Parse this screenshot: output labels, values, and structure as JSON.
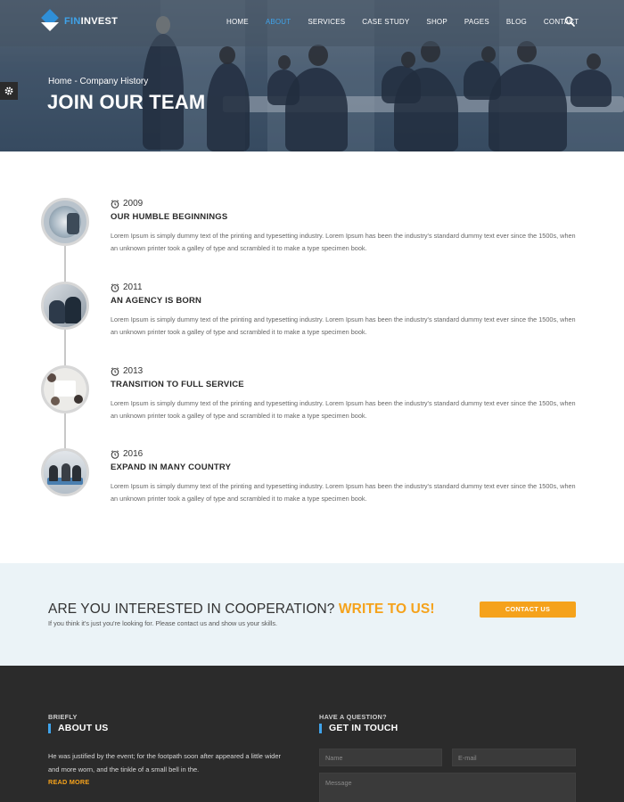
{
  "nav": {
    "logo_prefix": "FIN",
    "logo_suffix": "INVEST",
    "items": [
      {
        "label": "HOME",
        "active": false
      },
      {
        "label": "ABOUT",
        "active": true
      },
      {
        "label": "SERVICES",
        "active": false
      },
      {
        "label": "CASE STUDY",
        "active": false
      },
      {
        "label": "SHOP",
        "active": false
      },
      {
        "label": "PAGES",
        "active": false
      },
      {
        "label": "BLOG",
        "active": false
      },
      {
        "label": "CONTACT",
        "active": false
      }
    ],
    "search_icon": "search-icon"
  },
  "hero": {
    "breadcrumb": "Home - Company History",
    "title": "JOIN OUR TEAM"
  },
  "timeline": {
    "items": [
      {
        "year": "2009",
        "title": "OUR HUMBLE BEGINNINGS",
        "text": "Lorem Ipsum is simply dummy text of the printing and typesetting industry. Lorem Ipsum has been the industry's standard dummy text ever since the 1500s, when an unknown printer took a galley of type and scrambled it to make a type specimen book."
      },
      {
        "year": "2011",
        "title": "AN AGENCY IS BORN",
        "text": "Lorem Ipsum is simply dummy text of the printing and typesetting industry. Lorem Ipsum has been the industry's standard dummy text ever since the 1500s, when an unknown printer took a galley of type and scrambled it to make a type specimen book."
      },
      {
        "year": "2013",
        "title": "TRANSITION TO FULL SERVICE",
        "text": "Lorem Ipsum is simply dummy text of the printing and typesetting industry. Lorem Ipsum has been the industry's standard dummy text ever since the 1500s, when an unknown printer took a galley of type and scrambled it to make a type specimen book."
      },
      {
        "year": "2016",
        "title": "EXPAND IN MANY COUNTRY",
        "text": "Lorem Ipsum is simply dummy text of the printing and typesetting industry. Lorem Ipsum has been the industry's standard dummy text ever since the 1500s, when an unknown printer took a galley of type and scrambled it to make a type specimen book."
      }
    ]
  },
  "cta": {
    "heading": "ARE YOU INTERESTED IN COOPERATION?",
    "heading_accent": "WRITE TO US!",
    "subtext": "If you think it's just you're looking for. Please contact us and show us your skills.",
    "button": "CONTACT US"
  },
  "footer": {
    "about_kicker": "BRIEFLY",
    "about_title": "ABOUT US",
    "about_text": "He was justified by the event; for the footpath soon after appeared a little wider and more worn, and the tinkle of a small bell in the.",
    "read_more": "READ MORE",
    "contact_kicker": "HAVE A QUESTION?",
    "contact_title": "GET IN TOUCH",
    "name_placeholder": "Name",
    "email_placeholder": "E-mail",
    "message_placeholder": "Message"
  },
  "colors": {
    "accent_blue": "#3fa3ea",
    "accent_orange": "#f5a21b",
    "footer_bg": "#2b2b2b",
    "cta_bg": "#ebf3f7"
  }
}
